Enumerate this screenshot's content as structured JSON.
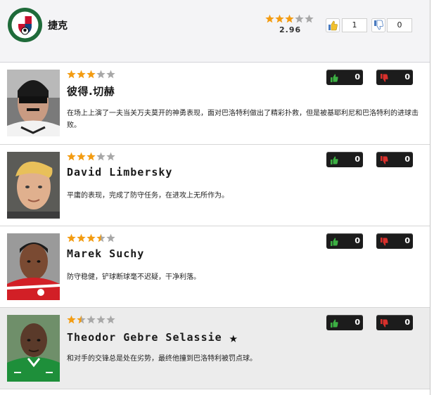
{
  "team": {
    "name": "捷克",
    "rating": 2.96,
    "rating_text": "2.96",
    "up_count": "1",
    "down_count": "0"
  },
  "colors": {
    "star_filled": "#f39c12",
    "star_empty": "#a8a8a8",
    "vote_up_icon": "#3cb043",
    "vote_down_icon": "#d9302c"
  },
  "players": [
    {
      "name": "彼得.切赫",
      "rating": 3,
      "comment": "在场上上演了一夫当关万夫莫开的神勇表现，面对巴洛特利做出了精彩扑救，但是被基耶利尼和巴洛特利的进球击败。",
      "up_count": "0",
      "down_count": "0",
      "highlight": false,
      "has_star": false
    },
    {
      "name": "David Limbersky",
      "rating": 3,
      "comment": "平庸的表现，完成了防守任务，在进攻上无所作为。",
      "up_count": "0",
      "down_count": "0",
      "highlight": false,
      "has_star": false
    },
    {
      "name": "Marek Suchy",
      "rating": 3.5,
      "comment": "防守稳健，铲球断球毫不迟疑，干净利落。",
      "up_count": "0",
      "down_count": "0",
      "highlight": false,
      "has_star": false
    },
    {
      "name": "Theodor Gebre Selassie",
      "rating": 1.5,
      "comment": "和对手的交锋总是处在劣势，最终他撞到巴洛特利被罚点球。",
      "up_count": "0",
      "down_count": "0",
      "highlight": true,
      "has_star": true
    }
  ],
  "icons": {
    "thumb_up": "thumbs-up-icon",
    "thumb_down": "thumbs-down-icon",
    "star": "star-icon"
  }
}
